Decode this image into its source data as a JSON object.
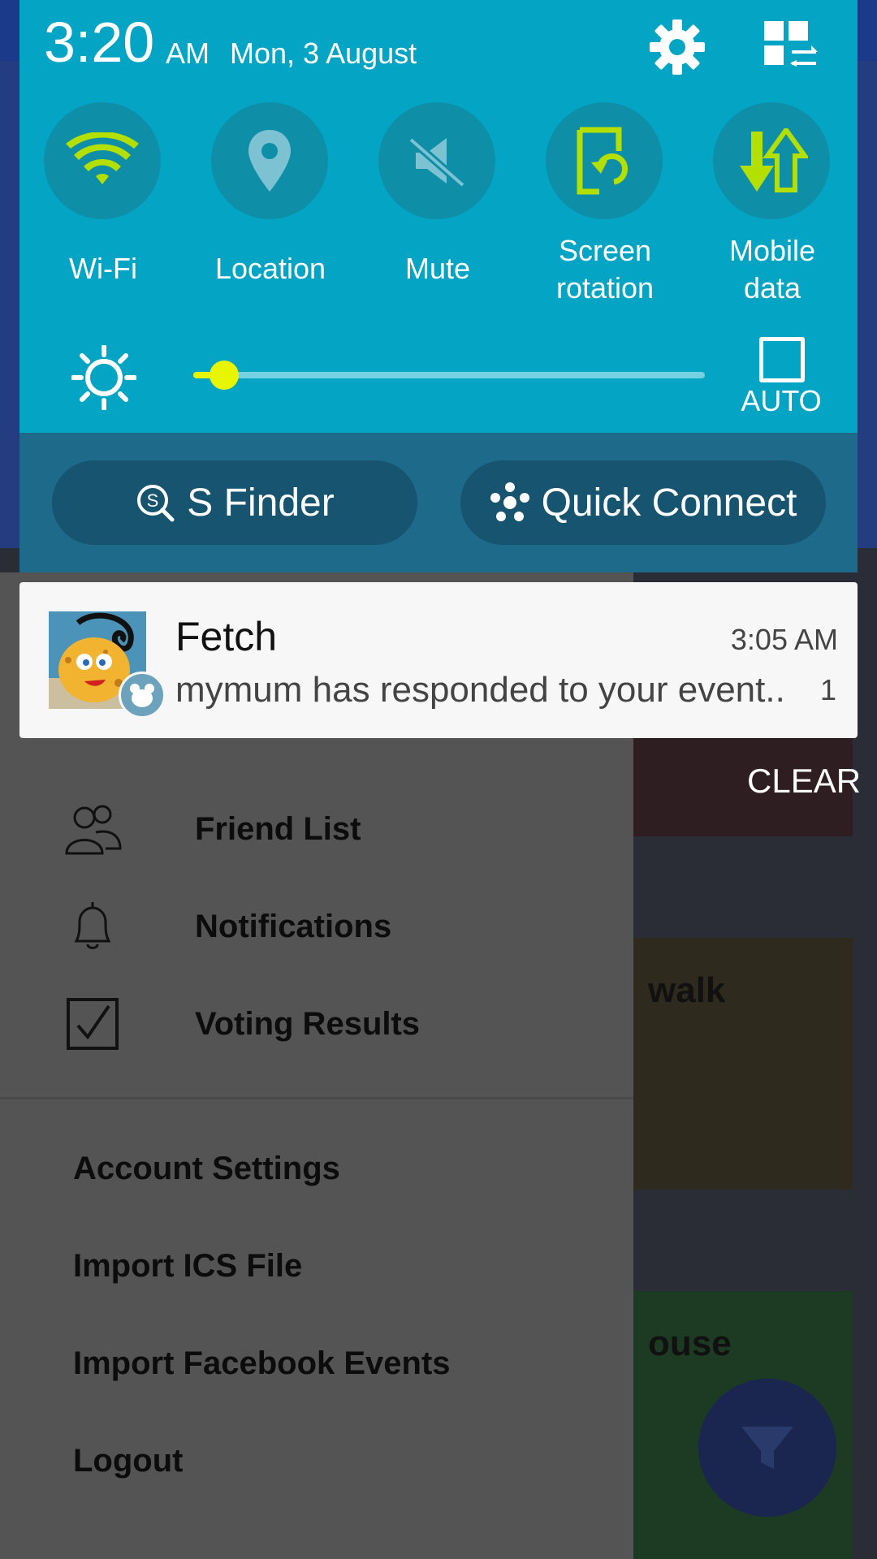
{
  "status": {
    "time": "3:20",
    "ampm": "AM",
    "date": "Mon, 3 August"
  },
  "quick_settings": [
    {
      "label_line1": "Wi-Fi",
      "label_line2": "",
      "icon": "wifi-icon",
      "active": true
    },
    {
      "label_line1": "Location",
      "label_line2": "",
      "icon": "location-icon",
      "active": false
    },
    {
      "label_line1": "Mute",
      "label_line2": "",
      "icon": "mute-icon",
      "active": false
    },
    {
      "label_line1": "Screen",
      "label_line2": "rotation",
      "icon": "screen-rotation-icon",
      "active": true
    },
    {
      "label_line1": "Mobile",
      "label_line2": "data",
      "icon": "mobile-data-icon",
      "active": true
    }
  ],
  "brightness": {
    "level": 0.06,
    "auto_label": "AUTO"
  },
  "shortcuts": {
    "s_finder": "S Finder",
    "quick_connect": "Quick Connect"
  },
  "notification": {
    "app": "Fetch",
    "time": "3:05 AM",
    "body": "mymum has responded to your event..",
    "count": "1"
  },
  "clear_label": "CLEAR",
  "drawer": {
    "items": [
      {
        "label": "Friend List",
        "icon": "friends-icon"
      },
      {
        "label": "Notifications",
        "icon": "bell-icon"
      },
      {
        "label": "Voting Results",
        "icon": "checkbox-icon"
      }
    ],
    "links": [
      "Account Settings",
      "Import ICS File",
      "Import Facebook Events",
      "Logout"
    ]
  },
  "background_cards": {
    "card2_title": "walk",
    "card3_title": "ouse"
  },
  "colors": {
    "shade": "#03a4c4",
    "accent": "#b3e000",
    "slider": "#e8f500"
  }
}
